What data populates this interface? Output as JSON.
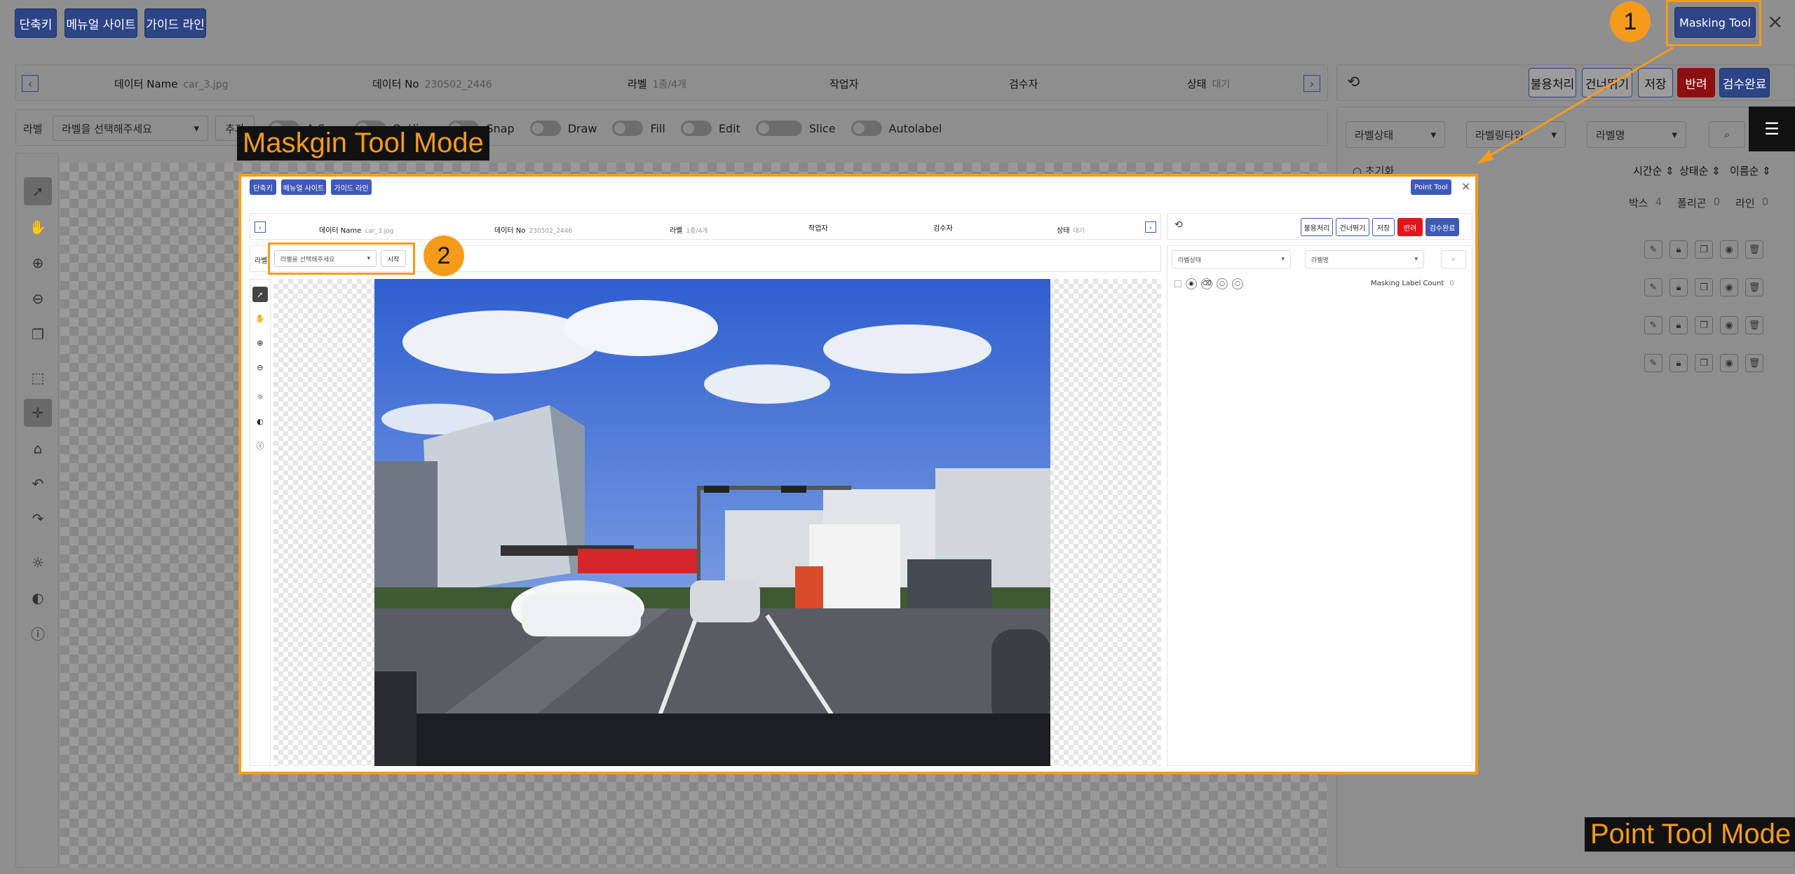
{
  "topbar": {
    "shortcut": "단축키",
    "manual": "메뉴얼 사이트",
    "guide": "가이드 라인",
    "masking_tool": "Masking Tool",
    "close": "×"
  },
  "header": {
    "data_name_label": "데이터 Name",
    "data_name_value": "car_3.jpg",
    "data_no_label": "데이터 No",
    "data_no_value": "230502_2446",
    "label_label": "라벨",
    "label_value": "1종/4개",
    "worker_label": "작업자",
    "inspector_label": "검수자",
    "status_label": "상태",
    "status_value": "대기"
  },
  "actions": {
    "unused": "불용처리",
    "skip": "건너뛰기",
    "save": "저장",
    "reject": "반려",
    "complete": "검수완료"
  },
  "labelbar": {
    "label": "라벨",
    "placeholder": "라벨을 선택해주세요",
    "add": "추가",
    "tools": [
      "A-Seg",
      "Outline",
      "Snap",
      "Draw",
      "Fill",
      "Edit",
      "Slice",
      "Autolabel"
    ]
  },
  "right_panel": {
    "filter_status": "라벨상태",
    "filter_type": "라벨링타입",
    "filter_name": "라벨명",
    "reset": "초기화",
    "sort_time": "시간순",
    "sort_status": "상태순",
    "sort_name": "이름순",
    "box_label": "박스",
    "box_count": "4",
    "polygon_label": "폴리곤",
    "polygon_count": "0",
    "line_label": "라인",
    "line_count": "0"
  },
  "overlay": {
    "shortcut": "단축키",
    "manual": "메뉴얼 사이트",
    "guide": "가이드 라인",
    "point_tool": "Point Tool",
    "close": "×",
    "data_name_label": "데이터 Name",
    "data_name_value": "car_3.jpg",
    "data_no_label": "데이터 No",
    "data_no_value": "230502_2446",
    "label_label": "라벨",
    "label_value": "1종/4개",
    "worker_label": "작업자",
    "inspector_label": "검수자",
    "status_label": "상태",
    "status_value": "대기",
    "unused": "불용처리",
    "skip": "건너뛰기",
    "save": "저장",
    "reject": "반려",
    "complete": "검수완료",
    "label": "라벨",
    "placeholder": "라벨을 선택해주세요",
    "start": "시작",
    "filter_status": "라벨상태",
    "filter_name": "라벨명",
    "mask_count_label": "Masking Label Count",
    "mask_count_value": "0"
  },
  "annotations": {
    "badge1": "1",
    "badge2": "2",
    "caption_masking": "Maskgin Tool Mode",
    "caption_point": "Point Tool Mode",
    "accent": "#f49b1c"
  },
  "icons": [
    "pointer-icon",
    "hand-icon",
    "zoom-in-icon",
    "zoom-out-icon",
    "copy-icon",
    "select-box-icon",
    "crosshair-icon",
    "tag-icon",
    "undo-icon",
    "redo-icon",
    "brightness-icon",
    "contrast-icon",
    "comment-icon",
    "history-icon",
    "search-icon",
    "menu-icon",
    "lock-icon",
    "eye-icon",
    "trash-icon"
  ]
}
